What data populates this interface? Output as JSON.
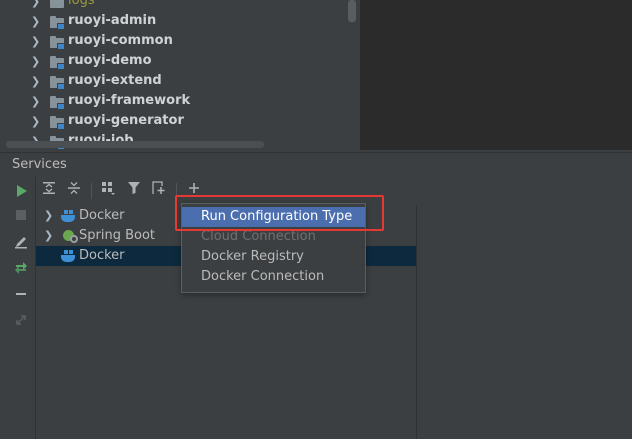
{
  "project_tree": {
    "items": [
      {
        "label": "logs",
        "expandable": true
      },
      {
        "label": "ruoyi-admin",
        "expandable": true
      },
      {
        "label": "ruoyi-common",
        "expandable": true
      },
      {
        "label": "ruoyi-demo",
        "expandable": true
      },
      {
        "label": "ruoyi-extend",
        "expandable": true
      },
      {
        "label": "ruoyi-framework",
        "expandable": true
      },
      {
        "label": "ruoyi-generator",
        "expandable": true
      },
      {
        "label": "ruoyi-job",
        "expandable": true
      }
    ]
  },
  "services": {
    "title": "Services",
    "tree": [
      {
        "label": "Docker",
        "icon": "docker-icon",
        "expandable": true,
        "selected": false
      },
      {
        "label": "Spring Boot",
        "icon": "spring-boot-icon",
        "expandable": true,
        "selected": false
      },
      {
        "label": "Docker",
        "icon": "docker-icon",
        "expandable": false,
        "selected": true
      }
    ]
  },
  "add_menu": {
    "items": [
      {
        "label": "Run Configuration Type",
        "state": "active"
      },
      {
        "label": "Cloud Connection",
        "state": "disabled"
      },
      {
        "label": "Docker Registry",
        "state": "normal"
      },
      {
        "label": "Docker Connection",
        "state": "normal"
      }
    ]
  },
  "colors": {
    "highlight_border": "#e53935",
    "menu_active": "#4b6eaf",
    "selected_row": "#0d293e",
    "run_green": "#59a869"
  }
}
